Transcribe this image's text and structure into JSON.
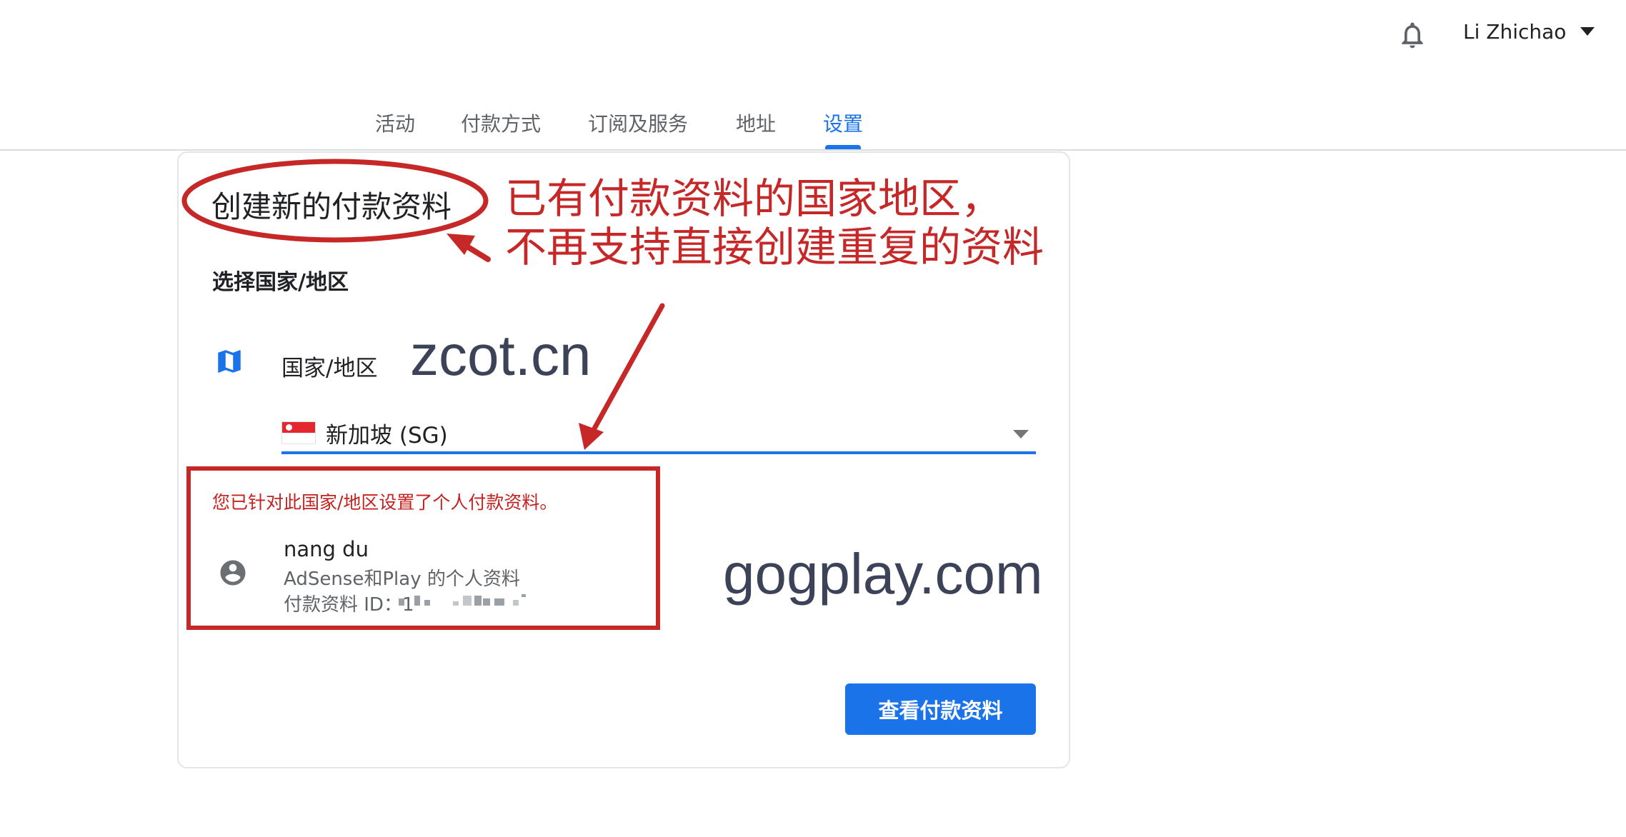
{
  "header": {
    "user_name": "Li Zhichao",
    "icons": [
      "bell-icon",
      "caret-down-icon"
    ]
  },
  "tabs": [
    {
      "label": "活动",
      "active": false
    },
    {
      "label": "付款方式",
      "active": false
    },
    {
      "label": "订阅及服务",
      "active": false
    },
    {
      "label": "地址",
      "active": false
    },
    {
      "label": "设置",
      "active": true
    }
  ],
  "card": {
    "title": "创建新的付款资料",
    "section_label": "选择国家/地区",
    "country_label": "国家/地区",
    "country_select": {
      "value": "新加坡 (SG)",
      "flag": "singapore-flag-icon"
    },
    "warning": "您已针对此国家/地区设置了个人付款资料。",
    "profile": {
      "name": "nang du",
      "type": "AdSense和Play 的个人资料",
      "id_label": "付款资料 ID：1"
    },
    "view_button": "查看付款资料"
  },
  "annotation": {
    "line1": "已有付款资料的国家地区，",
    "line2": "不再支持直接创建重复的资料"
  },
  "watermarks": {
    "top": "zcot.cn",
    "bottom": "gogplay.com"
  },
  "colors": {
    "accent": "#1a73e8",
    "annotation_red": "#c62828",
    "warning_red": "#c5221f"
  }
}
